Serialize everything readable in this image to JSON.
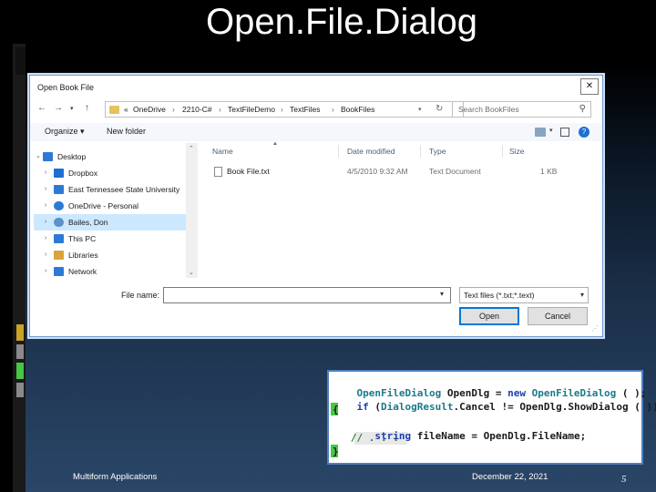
{
  "slide": {
    "title": "Open.File.Dialog",
    "footer_left": "Multiform Applications",
    "footer_date": "December 22, 2021",
    "page_number": "5"
  },
  "dialog": {
    "title": "Open Book File",
    "close_icon": "close-icon",
    "address": {
      "crumbs": [
        "«",
        "OneDrive",
        "2210-C#",
        "TextFileDemo",
        "TextFiles",
        "BookFiles"
      ],
      "search_placeholder": "Search BookFiles"
    },
    "toolbar": {
      "organize_label": "Organize ▾",
      "new_folder_label": "New folder"
    },
    "nav_items": [
      {
        "label": "Desktop",
        "icon": "desktop-icon",
        "color": "#2d7ad6"
      },
      {
        "label": "Dropbox",
        "icon": "dropbox-icon",
        "color": "#1f6fd0"
      },
      {
        "label": "East Tennessee State University",
        "icon": "folder-icon",
        "color": "#2d7ad6"
      },
      {
        "label": "OneDrive - Personal",
        "icon": "cloud-icon",
        "color": "#2d7ad6"
      },
      {
        "label": "Bailes, Don",
        "icon": "user-icon",
        "color": "#5a8fd0"
      },
      {
        "label": "This PC",
        "icon": "computer-icon",
        "color": "#2d7ad6"
      },
      {
        "label": "Libraries",
        "icon": "library-icon",
        "color": "#d9a43a"
      },
      {
        "label": "Network",
        "icon": "network-icon",
        "color": "#2d7ad6"
      }
    ],
    "selected_nav": "Bailes, Don",
    "columns": [
      "Name",
      "Date modified",
      "Type",
      "Size"
    ],
    "files": [
      {
        "name": "Book File.txt",
        "date": "4/5/2010 9:32 AM",
        "type": "Text Document",
        "size": "1 KB"
      }
    ],
    "filename_label": "File name:",
    "filename_value": "",
    "filter_value": "Text files (*.txt;*.text)",
    "open_label": "Open",
    "cancel_label": "Cancel"
  },
  "code": {
    "lines": [
      "OpenFileDialog OpenDlg = new OpenFileDialog ( );",
      "if (DialogResult.Cancel != OpenDlg.ShowDialog ( ))",
      "{",
      "   string fileName = OpenDlg.FileName;",
      "   // . . .",
      "}"
    ]
  },
  "colors": {
    "keyword": "#1a3fb0",
    "type": "#1a7a8a",
    "text": "#1b1b1b",
    "comment": "#2e7d32",
    "accent_green": "#46c746",
    "accent_gold": "#c9a227"
  }
}
